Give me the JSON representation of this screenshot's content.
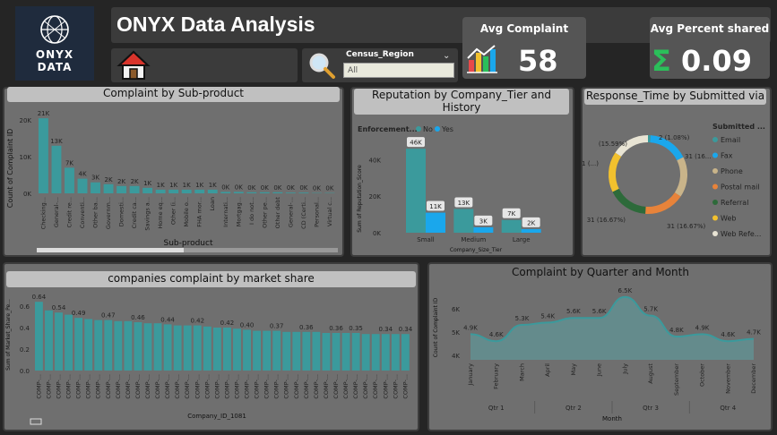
{
  "logo": {
    "line1": "ONYX",
    "line2": "DATA"
  },
  "header": {
    "title": "ONYX Data Analysis"
  },
  "filter": {
    "label": "Census_Region",
    "value": "All"
  },
  "kpis": [
    {
      "label": "Avg Complaint",
      "value": "58"
    },
    {
      "label": "Avg Percent shared",
      "value": "0.09"
    }
  ],
  "colors": {
    "teal": "#3b9a9c",
    "blue": "#1aa7ec",
    "panel": "#6f6f6f",
    "titlebar": "#c0c0c0",
    "kpi_green": "#2bbf5a"
  },
  "icons": [
    "home-icon",
    "search-icon",
    "chart-icon",
    "sigma-icon",
    "chevron-down-icon"
  ],
  "chart_data": [
    {
      "type": "bar",
      "title": "Complaint by Sub-product",
      "xlabel": "Sub-product",
      "ylabel": "Count of Complaint ID",
      "yticks": [
        "0K",
        "10K",
        "20K"
      ],
      "ylim": [
        0,
        22
      ],
      "categories": [
        "Checking...",
        "General-...",
        "Credit re...",
        "Conventi...",
        "Other ba...",
        "Governm...",
        "Domesti...",
        "Credit ca...",
        "Savings a...",
        "Home eq...",
        "Other (i...",
        "Mobile o...",
        "FHA mor...",
        "Loan",
        "Internati...",
        "Mortgag...",
        "I do not...",
        "Other pe...",
        "Other debt",
        "General-...",
        "CD (Certi...",
        "Personal...",
        "Virtual c..."
      ],
      "values": [
        20.5,
        13,
        7,
        4,
        3,
        2.5,
        2,
        2,
        1.5,
        1,
        1,
        1,
        1,
        1,
        0.4,
        0.4,
        0.3,
        0.3,
        0.3,
        0.2,
        0.2,
        0.1,
        0.1
      ],
      "labels": [
        "21K",
        "13K",
        "7K",
        "4K",
        "3K",
        "2K",
        "2K",
        "2K",
        "1K",
        "1K",
        "1K",
        "1K",
        "1K",
        "1K",
        "0K",
        "0K",
        "0K",
        "0K",
        "0K",
        "0K",
        "0K",
        "0K",
        "0K"
      ]
    },
    {
      "type": "bar",
      "title": "Reputation by Company_Tier and History",
      "legend_title": "Enforcement...",
      "xlabel": "Company_Size_Tier",
      "ylabel": "Sum of Reputation_Score",
      "yticks": [
        "0K",
        "20K",
        "40K"
      ],
      "ylim": [
        0,
        50
      ],
      "categories": [
        "Small",
        "Medium",
        "Large"
      ],
      "series": [
        {
          "name": "No",
          "values": [
            46,
            13,
            7
          ],
          "labels": [
            "46K",
            "13K",
            "7K"
          ]
        },
        {
          "name": "Yes",
          "values": [
            11,
            3,
            2
          ],
          "labels": [
            "11K",
            "3K",
            "2K"
          ]
        }
      ]
    },
    {
      "type": "pie",
      "title": "Response_Time by Submitted via",
      "legend_title": "Submitted ...",
      "slices": [
        {
          "name": "Email",
          "value": 2,
          "color": "#3b9a9c",
          "label": "2 (1.08%)"
        },
        {
          "name": "Fax",
          "value": 31,
          "color": "#1aa7ec",
          "label": "31 (16..."
        },
        {
          "name": "Phone",
          "value": 31,
          "color": "#c9b48a",
          "label": ""
        },
        {
          "name": "Postal mail",
          "value": 31,
          "color": "#e8833a",
          "label": "31 (16.67%)"
        },
        {
          "name": "Referral",
          "value": 31,
          "color": "#2d6a3a",
          "label": "31 (16.67%)"
        },
        {
          "name": "Web",
          "value": 31,
          "color": "#f2c12e",
          "label": "31 (...)"
        },
        {
          "name": "Web Refe...",
          "value": 29,
          "color": "#e8e4d4",
          "label": "(15.59%)"
        }
      ]
    },
    {
      "type": "bar",
      "title": "companies complaint by market share",
      "xlabel": "Company_ID_1081",
      "ylabel": "Sum of Market_Share_Pe...",
      "yticks": [
        "0.0",
        "0.2",
        "0.4",
        "0.6"
      ],
      "ylim": [
        0,
        0.7
      ],
      "category_label": "COMP-...",
      "values": [
        0.64,
        0.56,
        0.54,
        0.52,
        0.49,
        0.48,
        0.47,
        0.47,
        0.46,
        0.46,
        0.45,
        0.44,
        0.44,
        0.43,
        0.42,
        0.42,
        0.42,
        0.41,
        0.4,
        0.4,
        0.39,
        0.38,
        0.37,
        0.37,
        0.37,
        0.36,
        0.36,
        0.36,
        0.36,
        0.35,
        0.35,
        0.35,
        0.35,
        0.34,
        0.34,
        0.34,
        0.34,
        0.34
      ],
      "labels": {
        "0": "0.64",
        "2": "0.54",
        "4": "0.49",
        "7": "0.47",
        "10": "0.46",
        "13": "0.44",
        "16": "0.42",
        "19": "0.42",
        "21": "0.40",
        "24": "0.37",
        "27": "0.36",
        "30": "0.36",
        "32": "0.35",
        "35": "0.34",
        "37": "0.34"
      }
    },
    {
      "type": "area",
      "title": "Complaint by Quarter and Month",
      "xlabel": "Month",
      "ylabel": "Count of Complaint ID",
      "yticks": [
        "4K",
        "5K",
        "6K"
      ],
      "ylim": [
        3.8,
        6.8
      ],
      "x": [
        "January",
        "February",
        "March",
        "April",
        "May",
        "June",
        "July",
        "August",
        "September",
        "October",
        "November",
        "December"
      ],
      "values": [
        4.9,
        4.6,
        5.3,
        5.4,
        5.6,
        5.6,
        6.5,
        5.7,
        4.8,
        4.9,
        4.6,
        4.7
      ],
      "labels": [
        "4.9K",
        "4.6K",
        "5.3K",
        "5.4K",
        "5.6K",
        "5.6K",
        "6.5K",
        "5.7K",
        "4.8K",
        "4.9K",
        "4.6K",
        "4.7K"
      ],
      "quarters": [
        "Qtr 1",
        "Qtr 2",
        "Qtr 3",
        "Qtr 4"
      ]
    }
  ]
}
